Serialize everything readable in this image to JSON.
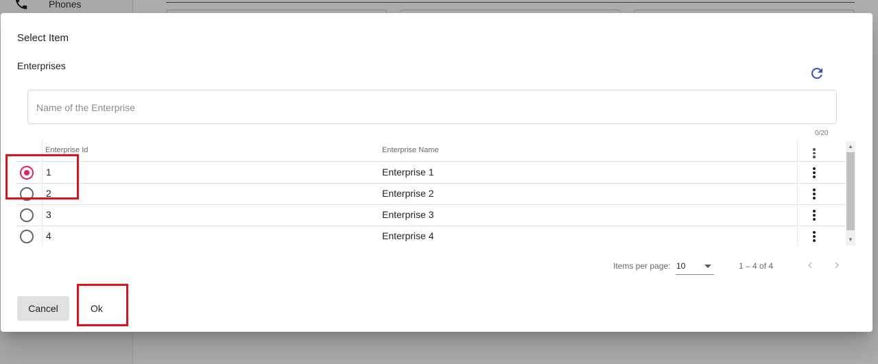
{
  "background": {
    "nav_item_label": "Phones"
  },
  "dialog": {
    "title": "Select Item",
    "section_title": "Enterprises",
    "search": {
      "value": "",
      "placeholder": "Name of the Enterprise",
      "char_count": "0/20"
    },
    "table": {
      "columns": [
        "Enterprise Id",
        "Enterprise Name"
      ],
      "rows": [
        {
          "id": "1",
          "name": "Enterprise 1",
          "selected": true
        },
        {
          "id": "2",
          "name": "Enterprise 2",
          "selected": false
        },
        {
          "id": "3",
          "name": "Enterprise 3",
          "selected": false
        },
        {
          "id": "4",
          "name": "Enterprise 4",
          "selected": false
        }
      ]
    },
    "paginator": {
      "items_per_page_label": "Items per page:",
      "page_size": "10",
      "range_label": "1 – 4 of 4"
    },
    "actions": {
      "cancel_label": "Cancel",
      "ok_label": "Ok"
    }
  },
  "colors": {
    "accent": "#e91e63",
    "refresh_icon": "#3f51b5",
    "highlight_box": "#e3101a"
  },
  "icons": [
    "phone-icon",
    "chevron-up-icon",
    "refresh-icon",
    "more-vert-icon",
    "chevron-left-icon",
    "chevron-right-icon",
    "dropdown-arrow-icon"
  ]
}
